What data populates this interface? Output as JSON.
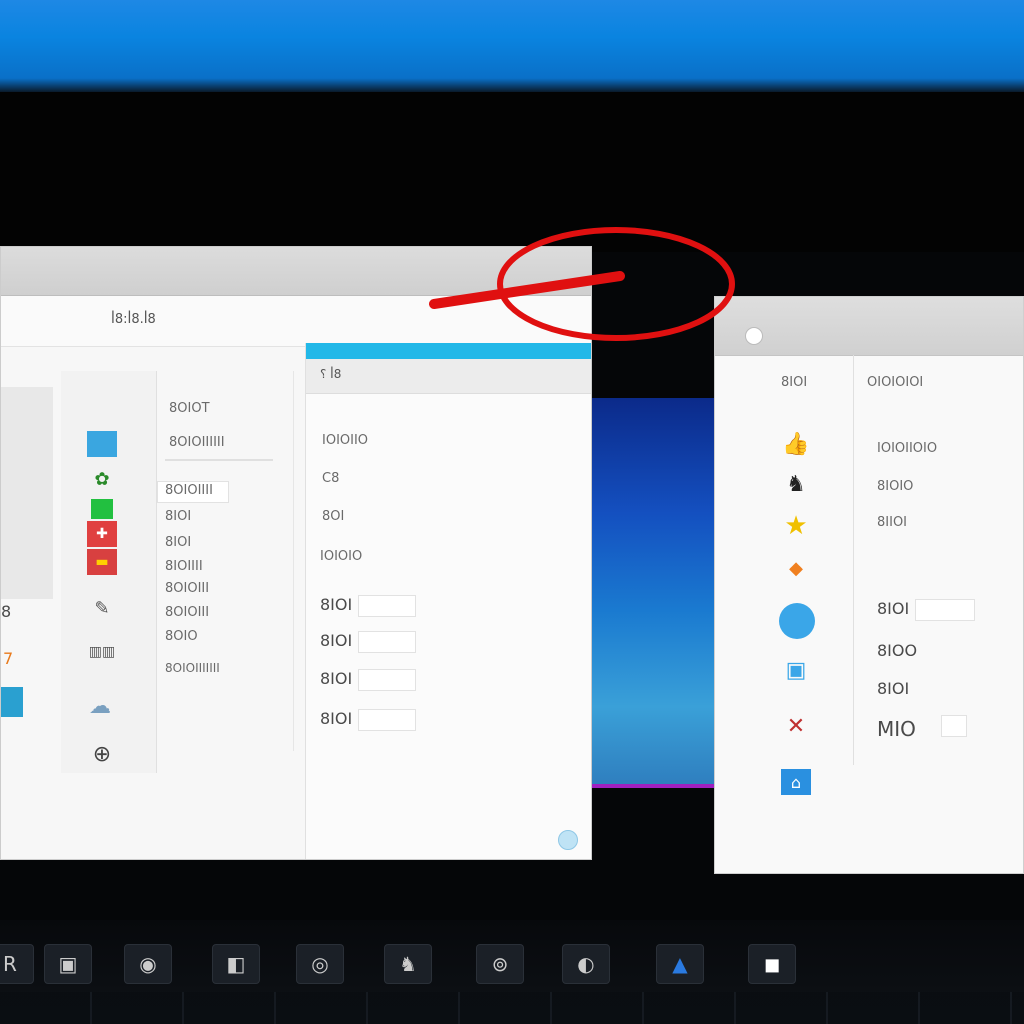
{
  "left_window": {
    "toolbar_label": "ꟾ8:ꟾ8.ꟾ8",
    "sub_header": "⸮ ꟾ8",
    "list_labels": [
      "8OIOT",
      "8OIOIIIIII",
      "8OIOIIII",
      "8IOI",
      "8IOI",
      "8IOIIII",
      "8OIOIII",
      "8OIOIII",
      "8OIO",
      "8OIOIIIIIII"
    ],
    "right_labels": [
      "IOIOIIO",
      "C8",
      "8OI",
      "IOIOIO",
      "8IOI",
      "8IOI",
      "8IOI",
      "8IOI"
    ],
    "edge_labels": [
      "8",
      "7"
    ]
  },
  "right_window": {
    "header_left": "8IOI",
    "header_right": "OIOIOIOI",
    "labels": [
      "IOIOIIOIO",
      "8IOIO",
      "8IIOI",
      "8IOI",
      "8IOO",
      "8IOI",
      "MIO"
    ]
  },
  "taskbar": {
    "items": [
      "R",
      "▣",
      "◉",
      "◧",
      "◎",
      "♞",
      "⊚",
      "◐",
      "▲",
      "◼"
    ]
  },
  "icons": {
    "left_column": [
      "blue-tile-icon",
      "green-figure-icon",
      "green-square-icon",
      "red-tile-icon",
      "red-car-icon",
      "pen-icon",
      "grid-device-icon",
      "cloud-icon",
      "plus-circle-icon"
    ],
    "right_column": [
      "yellow-thumb-icon",
      "black-figure-icon",
      "yellow-star-icon",
      "orange-badge-icon",
      "blue-sphere-icon",
      "frame-icon",
      "crossed-icon",
      "blue-tab-icon"
    ]
  },
  "colors": {
    "accent_blue": "#22b8e8",
    "annotation_red": "#e01010"
  }
}
